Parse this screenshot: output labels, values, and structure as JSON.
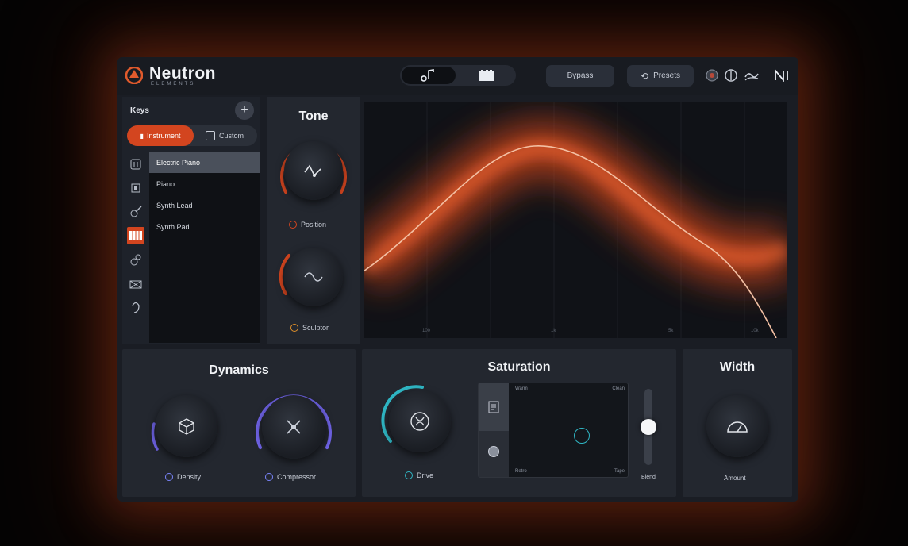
{
  "app": {
    "title": "Neutron",
    "subtitle": "ELEMENTS"
  },
  "header": {
    "mode_icons": [
      "music-note-icon",
      "keys-grid-icon"
    ],
    "bypass_label": "Bypass",
    "presets_label": "Presets",
    "right_icons": [
      "settings-dot-icon",
      "gain-meter-icon",
      "wave-icon",
      "ni-logo-icon"
    ]
  },
  "browser": {
    "label": "Keys",
    "add_symbol": "+",
    "toggle_on_label": "Instrument",
    "toggle_off_label": "Custom",
    "categories": [
      "mixer-icon",
      "box-icon",
      "guitar-icon",
      "keys-icon",
      "bass-icon",
      "drum-icon",
      "voice-icon"
    ],
    "active_category": 3,
    "items": [
      "Electric Piano",
      "Piano",
      "Synth Lead",
      "Synth Pad"
    ],
    "selected_item": 0
  },
  "tone": {
    "title": "Tone",
    "knob1_label": "Position",
    "knob2_label": "Sculptor"
  },
  "graph": {
    "labels": [
      "100",
      "1k",
      "5k",
      "10k"
    ],
    "curve_color": "#f0b89a",
    "glow_color": "#e0501e"
  },
  "dynamics": {
    "title": "Dynamics",
    "knob1_label": "Density",
    "knob2_label": "Compressor"
  },
  "saturation": {
    "title": "Saturation",
    "knob_label": "Drive",
    "corners": {
      "tl": "Warm",
      "tr": "Clean",
      "bl": "Retro",
      "br": "Tape"
    },
    "slider_label": "Blend"
  },
  "width": {
    "title": "Width",
    "knob_label": "Amount"
  },
  "colors": {
    "accent": "#d3451f",
    "teal": "#2fb6c4",
    "purple": "#6f63e6"
  }
}
